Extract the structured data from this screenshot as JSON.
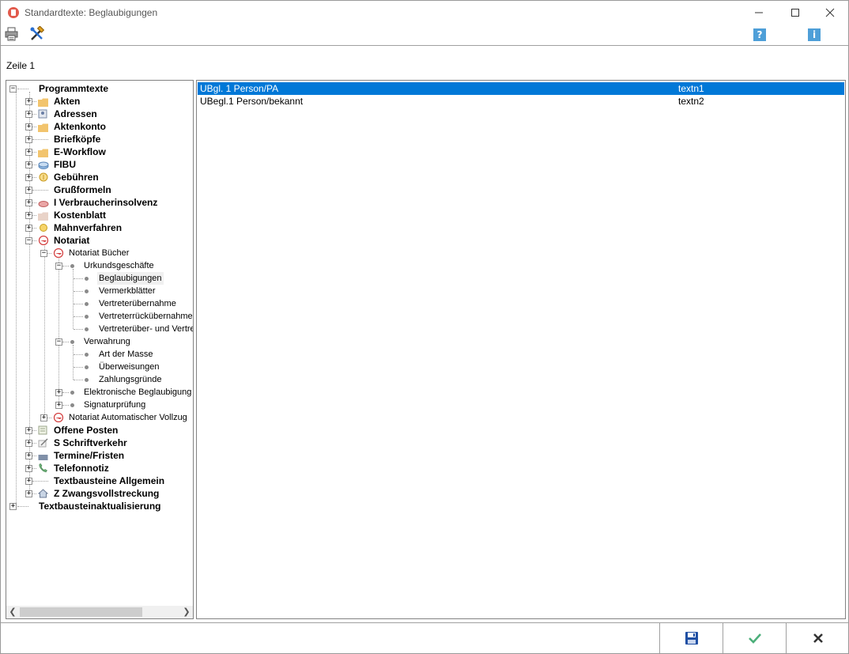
{
  "window": {
    "title": "Standardtexte: Beglaubigungen"
  },
  "toolbar": {
    "icons": [
      "printer-icon",
      "tools-icon",
      "help-icon",
      "info-icon"
    ],
    "help_label": "?",
    "info_label": "i"
  },
  "status": {
    "row_label": "Zeile 1"
  },
  "tree": {
    "root": "Programmtexte",
    "items": [
      "Akten",
      "Adressen",
      "Aktenkonto",
      "Briefköpfe",
      "E-Workflow",
      "FIBU",
      "Gebühren",
      "Grußformeln",
      "I Verbraucherinsolvenz",
      "Kostenblatt",
      "Mahnverfahren",
      "Notariat",
      "Offene Posten",
      "S Schriftverkehr",
      "Termine/Fristen",
      "Telefonnotiz",
      "Textbausteine Allgemein",
      "Z Zwangsvollstreckung"
    ],
    "notariat": {
      "buecher": "Notariat Bücher",
      "urkundsgeschaefte": "Urkundsgeschäfte",
      "urkunds_items": [
        "Beglaubigungen",
        "Vermerkblätter",
        "Vertreterübernahme",
        "Vertreterrückübernahme",
        "Vertreterüber- und Vertret"
      ],
      "verwahrung": "Verwahrung",
      "verwahrung_items": [
        "Art der Masse",
        "Überweisungen",
        "Zahlungsgründe"
      ],
      "elektronische": "Elektronische Beglaubigung",
      "signatur": "Signaturprüfung",
      "vollzug": "Notariat Automatischer Vollzug"
    },
    "last_root": "Textbausteinaktualisierung"
  },
  "list": {
    "rows": [
      {
        "name": "UBgl. 1 Person/PA",
        "code": "textn1"
      },
      {
        "name": "UBegl.1 Person/bekannt",
        "code": "textn2"
      }
    ],
    "accent": "#0078d7"
  },
  "footer": {
    "icons": [
      "save-icon",
      "confirm-icon",
      "cancel-icon"
    ]
  }
}
